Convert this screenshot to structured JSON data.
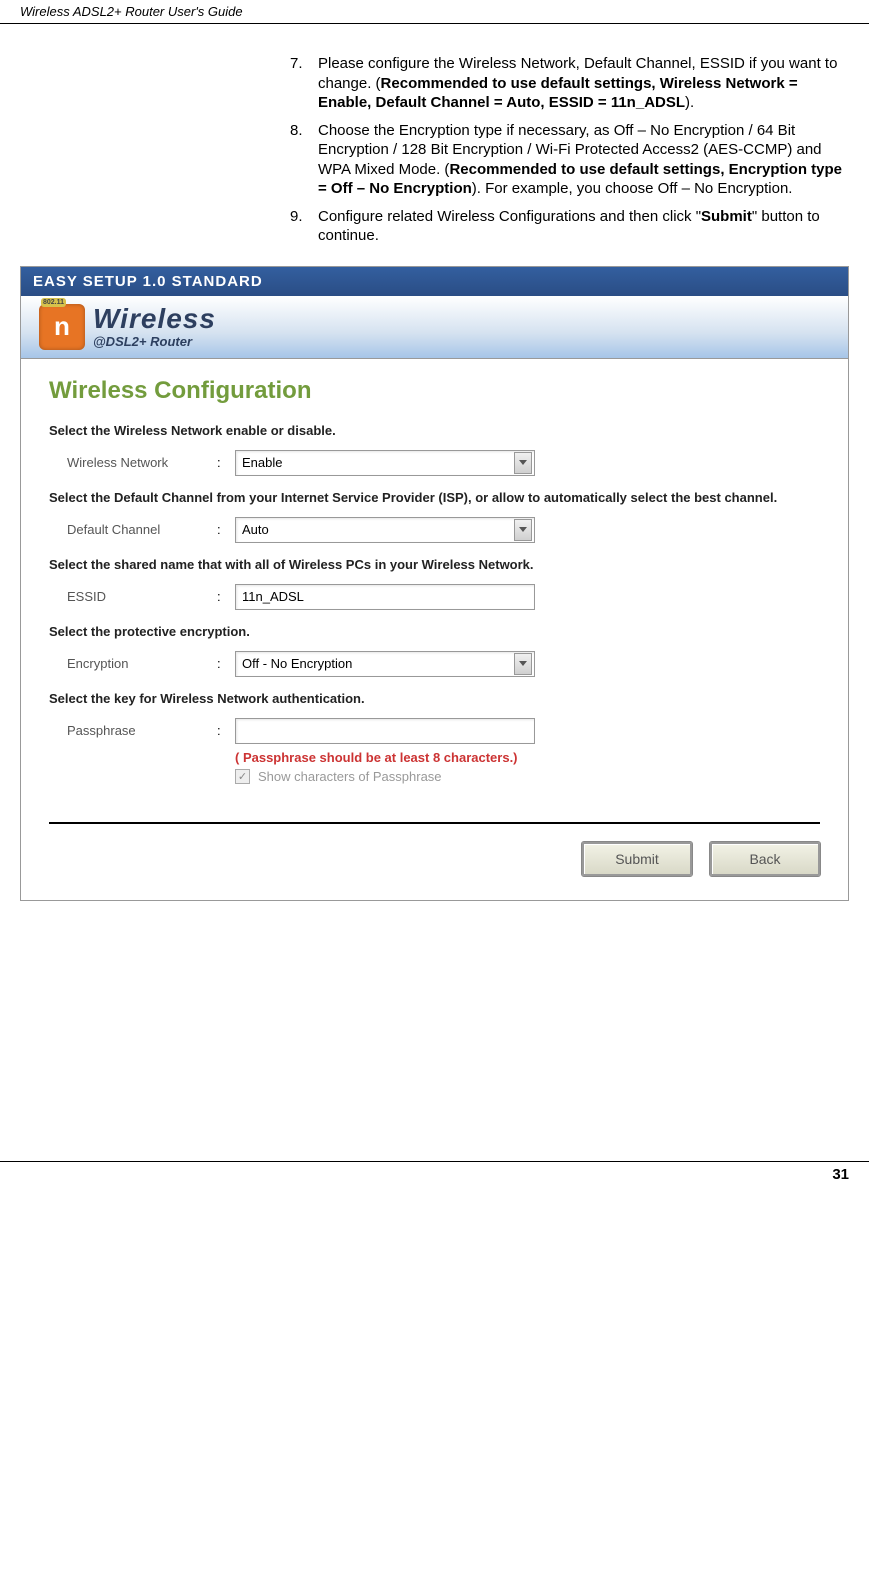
{
  "header": {
    "guide_title": "Wireless ADSL2+ Router User's Guide"
  },
  "instructions": {
    "items": [
      {
        "num": "7.",
        "text_pre": "Please configure the Wireless Network, Default Channel, ESSID if you want to change. (",
        "bold": "Recommended to use default settings, Wireless Network = Enable, Default Channel = Auto, ESSID = 11n_ADSL",
        "text_post": ")."
      },
      {
        "num": "8.",
        "text_pre": "Choose the Encryption type if necessary, as Off – No Encryption / 64 Bit Encryption / 128 Bit Encryption / Wi-Fi Protected Access2 (AES-CCMP) and WPA Mixed Mode. (",
        "bold": "Recommended to use default settings, Encryption type = Off – No Encryption",
        "text_post": "). For example, you choose Off – No Encryption."
      },
      {
        "num": "9.",
        "text_pre": "Configure related Wireless Configurations and then click \"",
        "bold": "Submit",
        "text_post": "\" button to continue."
      }
    ]
  },
  "screenshot": {
    "title_bar": "EASY SETUP 1.0 STANDARD",
    "logo": {
      "n": "n",
      "badge": "802.11",
      "wireless": "Wireless",
      "sub": "@DSL2+ Router"
    },
    "section_title": "Wireless Configuration",
    "prompts": {
      "network": "Select the Wireless Network enable or disable.",
      "channel": "Select the Default Channel from your Internet Service Provider (ISP),  or allow to automatically select the best channel.",
      "essid": "Select the shared name that with all of Wireless PCs in your Wireless Network.",
      "encryption": "Select the protective encryption.",
      "key": "Select the key for Wireless Network authentication."
    },
    "fields": {
      "wireless_network": {
        "label": "Wireless Network",
        "value": "Enable"
      },
      "default_channel": {
        "label": "Default Channel",
        "value": "Auto"
      },
      "essid": {
        "label": "ESSID",
        "value": "11n_ADSL"
      },
      "encryption": {
        "label": "Encryption",
        "value": "Off - No Encryption"
      },
      "passphrase": {
        "label": "Passphrase",
        "value": ""
      }
    },
    "warn": "( Passphrase should be at least 8 characters.)",
    "show_chars_label": "Show characters of Passphrase",
    "buttons": {
      "submit": "Submit",
      "back": "Back"
    }
  },
  "page_number": "31"
}
